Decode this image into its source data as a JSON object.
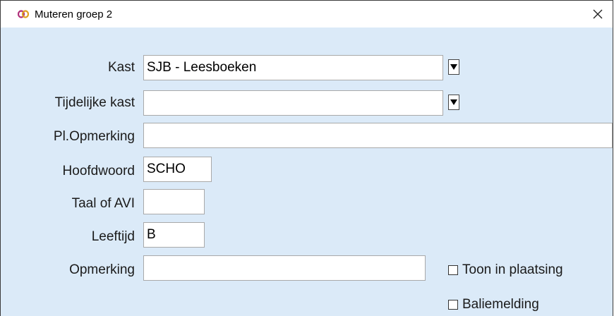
{
  "window": {
    "title": "Muteren groep 2",
    "close_symbol": "✕"
  },
  "fields": [
    {
      "label": "Kast",
      "value": "SJB - Leesboeken"
    },
    {
      "label": "Tijdelijke kast",
      "value": ""
    },
    {
      "label": "Pl.Opmerking",
      "value": ""
    },
    {
      "label": "Hoofdwoord",
      "value": "SCHO"
    },
    {
      "label": "Taal of AVI",
      "value": ""
    },
    {
      "label": "Leeftijd",
      "value": "B"
    },
    {
      "label": "Opmerking",
      "value": ""
    }
  ],
  "checkboxes": [
    {
      "label": "Toon in plaatsing",
      "checked": false
    },
    {
      "label": "Baliemelding",
      "checked": false
    }
  ],
  "colors": {
    "client_bg": "#dbeaf8",
    "title_bg": "#ffffff",
    "icon": "#b0307a"
  },
  "icons": {
    "app": "app-logo-icon",
    "close": "close-icon",
    "dropdown": "dropdown-arrow-icon"
  }
}
